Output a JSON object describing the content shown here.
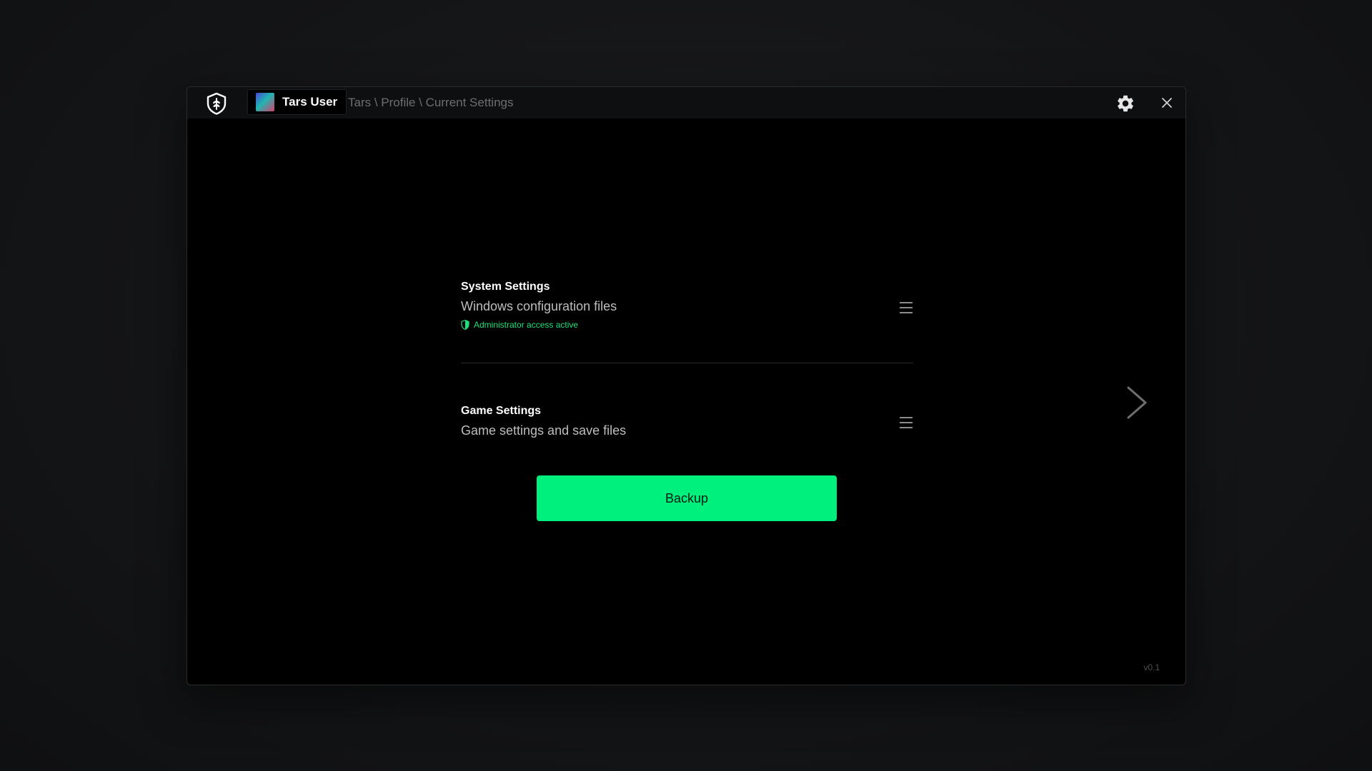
{
  "header": {
    "user_name": "Tars User",
    "breadcrumb": "Tars \\ Profile \\ Current Settings",
    "icons": {
      "logo": "shield-logo-icon",
      "avatar": "gradient-avatar",
      "settings": "gear-icon",
      "close": "close-icon"
    }
  },
  "main": {
    "items": [
      {
        "title": "System Settings",
        "description": "Windows configuration files",
        "status": "Administrator access active",
        "status_icon": "shield-icon",
        "menu_icon": "hamburger-menu-icon"
      },
      {
        "title": "Game Settings",
        "description": "Game settings and save files",
        "menu_icon": "hamburger-menu-icon"
      }
    ],
    "backup_label": "Backup",
    "next_icon": "chevron-right-icon"
  },
  "footer": {
    "version": "v0.1"
  },
  "colors": {
    "accent": "#00f07e",
    "status_green": "#1fe07a",
    "window_bg": "#000000",
    "titlebar_bg": "#0e0f10"
  }
}
